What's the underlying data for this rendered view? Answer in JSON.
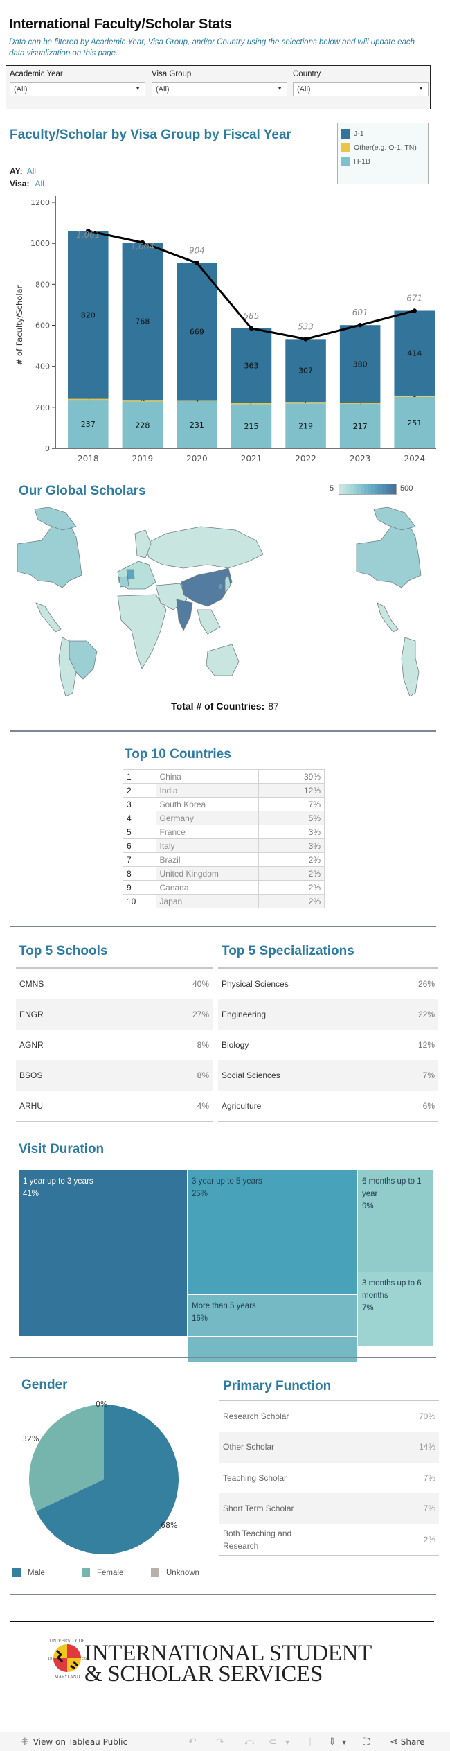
{
  "header": {
    "title": "International Faculty/Scholar Stats",
    "subtitle": "Data can be filtered by Academic Year, Visa Group, and/or Country using the selections below and will update each data visualization on this page."
  },
  "filters": [
    {
      "label": "Academic Year",
      "value": "(All)"
    },
    {
      "label": "Visa Group",
      "value": "(All)"
    },
    {
      "label": "Country",
      "value": "(All)"
    }
  ],
  "visa_chart": {
    "title": "Faculty/Scholar by Visa Group by Fiscal Year",
    "ay_label": "AY:",
    "ay_value": "All",
    "visa_label": "Visa:",
    "visa_value": "All",
    "legend": [
      {
        "label": "J-1",
        "color": "#33749a"
      },
      {
        "label": "Other(e.g. O-1, TN)",
        "color": "#eac546"
      },
      {
        "label": "H-1B",
        "color": "#7fc0ca"
      }
    ]
  },
  "chart_data": {
    "type": "bar",
    "stacked": true,
    "title": "Faculty/Scholar by Visa Group by Fiscal Year",
    "xlabel": "",
    "ylabel": "# of Faculty/Scholar",
    "ylim": [
      0,
      1200
    ],
    "yticks": [
      0,
      200,
      400,
      600,
      800,
      1000,
      1200
    ],
    "categories": [
      "2018",
      "2019",
      "2020",
      "2021",
      "2022",
      "2023",
      "2024"
    ],
    "series": [
      {
        "name": "H-1B",
        "color": "#7fc0ca",
        "values": [
          237,
          228,
          231,
          215,
          219,
          217,
          251
        ]
      },
      {
        "name": "Other(e.g. O-1, TN)",
        "color": "#eac546",
        "values": [
          4,
          8,
          4,
          7,
          7,
          4,
          6
        ]
      },
      {
        "name": "J-1",
        "color": "#33749a",
        "values": [
          820,
          768,
          669,
          363,
          307,
          380,
          414
        ]
      }
    ],
    "totals": {
      "name": "Total",
      "type": "line",
      "color": "#000000",
      "values": [
        1061,
        1004,
        904,
        585,
        533,
        601,
        671
      ],
      "labels": [
        "1,061",
        "1,004",
        "904",
        "585",
        "533",
        "601",
        "671"
      ]
    },
    "legend_position": "top-right",
    "grid": false
  },
  "map": {
    "title": "Our Global Scholars",
    "legend_min": "5",
    "legend_max": "500",
    "total_label": "Total # of Countries:",
    "total_value": "87",
    "ramp": [
      "#c8e6df",
      "#bde2dc",
      "#b0dcd9",
      "#a5d6d7",
      "#98cfd4",
      "#8cc8d1",
      "#80c0cd",
      "#74b7ca",
      "#6aafc6",
      "#63a7c2",
      "#5d9ebd",
      "#5795b7",
      "#528cb0",
      "#4e83a9",
      "#4a79a2",
      "#47709a"
    ]
  },
  "top10": {
    "title": "Top 10 Countries",
    "rows": [
      {
        "rank": "1",
        "country": "China",
        "pct": "39%"
      },
      {
        "rank": "2",
        "country": "India",
        "pct": "12%"
      },
      {
        "rank": "3",
        "country": "South Korea",
        "pct": "7%"
      },
      {
        "rank": "4",
        "country": "Germany",
        "pct": "5%"
      },
      {
        "rank": "5",
        "country": "France",
        "pct": "3%"
      },
      {
        "rank": "6",
        "country": "Italy",
        "pct": "3%"
      },
      {
        "rank": "7",
        "country": "Brazil",
        "pct": "2%"
      },
      {
        "rank": "8",
        "country": "United Kingdom",
        "pct": "2%"
      },
      {
        "rank": "9",
        "country": "Canada",
        "pct": "2%"
      },
      {
        "rank": "10",
        "country": "Japan",
        "pct": "2%"
      }
    ]
  },
  "top_schools": {
    "title": "Top 5 Schools",
    "rows": [
      {
        "label": "CMNS",
        "pct": "40%"
      },
      {
        "label": "ENGR",
        "pct": "27%"
      },
      {
        "label": "AGNR",
        "pct": "8%"
      },
      {
        "label": "BSOS",
        "pct": "8%"
      },
      {
        "label": "ARHU",
        "pct": "4%"
      }
    ]
  },
  "top_specializations": {
    "title": "Top 5 Specializations",
    "rows": [
      {
        "label": "Physical Sciences",
        "pct": "26%"
      },
      {
        "label": "Engineering",
        "pct": "22%"
      },
      {
        "label": "Biology",
        "pct": "12%"
      },
      {
        "label": "Social Sciences",
        "pct": "7%"
      },
      {
        "label": "Agriculture",
        "pct": "6%"
      }
    ]
  },
  "visit_duration": {
    "title": "Visit Duration",
    "items": [
      {
        "label": "1 year up to 3 years",
        "pct": "41%",
        "color": "#33749a"
      },
      {
        "label": "3 year up to 5 years",
        "pct": "25%",
        "color": "#47a2ba"
      },
      {
        "label": "More than 5 years",
        "pct": "16%",
        "color": "#74b9c4"
      },
      {
        "label": "6 months up to 1 year",
        "pct": "9%",
        "color": "#91cccb"
      },
      {
        "label": "3 months up to 6 months",
        "pct": "7%",
        "color": "#9dd3d0"
      },
      {
        "label": "",
        "pct": "",
        "color": "#b1ddd6"
      }
    ]
  },
  "gender": {
    "title": "Gender",
    "slices": [
      {
        "label": "Male",
        "pct": "68%",
        "value": 68,
        "color": "#357f9f"
      },
      {
        "label": "Female",
        "pct": "32%",
        "value": 32,
        "color": "#76b5ae"
      },
      {
        "label": "Unknown",
        "pct": "0%",
        "value": 0,
        "color": "#b9b0ac"
      }
    ]
  },
  "primary_function": {
    "title": "Primary Function",
    "rows": [
      {
        "label": "Research Scholar",
        "pct": "70%"
      },
      {
        "label": "Other Scholar",
        "pct": "14%"
      },
      {
        "label": "Teaching Scholar",
        "pct": "7%"
      },
      {
        "label": "Short Term Scholar",
        "pct": "7%"
      },
      {
        "label": "Both Teaching and Research",
        "pct": "2%"
      }
    ]
  },
  "footer": {
    "logo_line1": "INTERNATIONAL STUDENT",
    "logo_line2": "& SCHOLAR SERVICES",
    "seal_top": "UNIVERSITY OF",
    "seal_bottom": "MARYLAND",
    "seal_left": "18",
    "seal_right": "56"
  },
  "toolbar": {
    "view_label": "View on Tableau Public",
    "share_label": "Share"
  }
}
